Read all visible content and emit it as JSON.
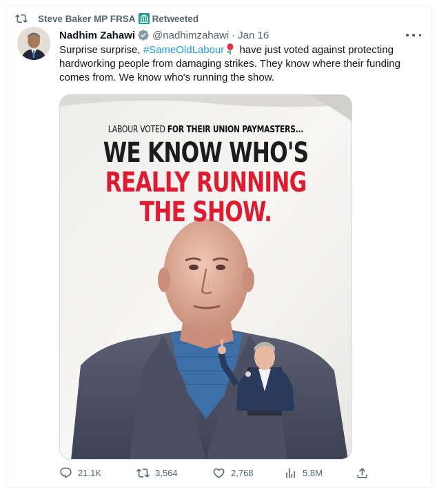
{
  "retweet": {
    "user": "Steve Baker MP FRSA",
    "label": "Retweeted"
  },
  "tweet": {
    "display_name": "Nadhim Zahawi",
    "handle": "@nadhimzahawi",
    "separator": "·",
    "date": "Jan 16",
    "text_before": "Surprise surprise, ",
    "hashtag": "#SameOldLabour",
    "text_after": " have just voted against protecting hardworking people from damaging strikes. They know where their funding comes from. We know who's running the show."
  },
  "poster": {
    "line1_normal": "LABOUR VOTED ",
    "line1_bold": "FOR THEIR UNION PAYMASTERS...",
    "line2": "WE KNOW WHO'S",
    "line3": "REALLY RUNNING",
    "line4": "THE SHOW.",
    "colors": {
      "red": "#e01b30",
      "dark": "#1c1c1c"
    }
  },
  "actions": {
    "replies": "21.1K",
    "retweets": "3,564",
    "likes": "2,768",
    "views": "5.8M"
  },
  "colors": {
    "accent": "#1d9bf0",
    "secondary_text": "#536471",
    "verified": "#829aab"
  }
}
